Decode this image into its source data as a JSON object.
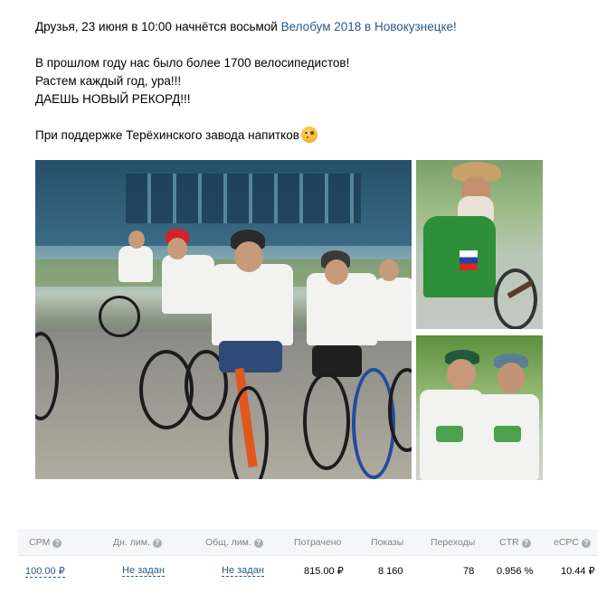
{
  "post": {
    "line1_prefix": "Друзья, 23 июня в 10:00 начнётся восьмой ",
    "line1_link": "Велобум 2018 в Новокузнецке!",
    "line2": "В прошлом году нас было более 1700 велосипедистов!",
    "line3": "Растем каждый год, ура!!!",
    "line4": "ДАЕШЬ НОВЫЙ РЕКОРД!!!",
    "line5": "При поддержке Терёхинского завода напитков",
    "emoji": "winking-face-icon"
  },
  "stats": {
    "headers": {
      "cpm": "CPM",
      "day_limit": "Дн. лим.",
      "total_limit": "Общ. лим.",
      "spent": "Потрачено",
      "impressions": "Показы",
      "clicks": "Переходы",
      "ctr": "CTR",
      "ecpc": "eCPC"
    },
    "help_glyph": "?",
    "row": {
      "cpm": "100.00 ₽",
      "day_limit": "Не задан",
      "total_limit": "Не задан",
      "spent": "815.00 ₽",
      "impressions": "8 160",
      "clicks": "78",
      "ctr": "0.956 %",
      "ecpc": "10.44 ₽"
    }
  },
  "colors": {
    "link": "#2a5885",
    "header_bg": "#f5f6f8",
    "header_text": "#828282"
  }
}
